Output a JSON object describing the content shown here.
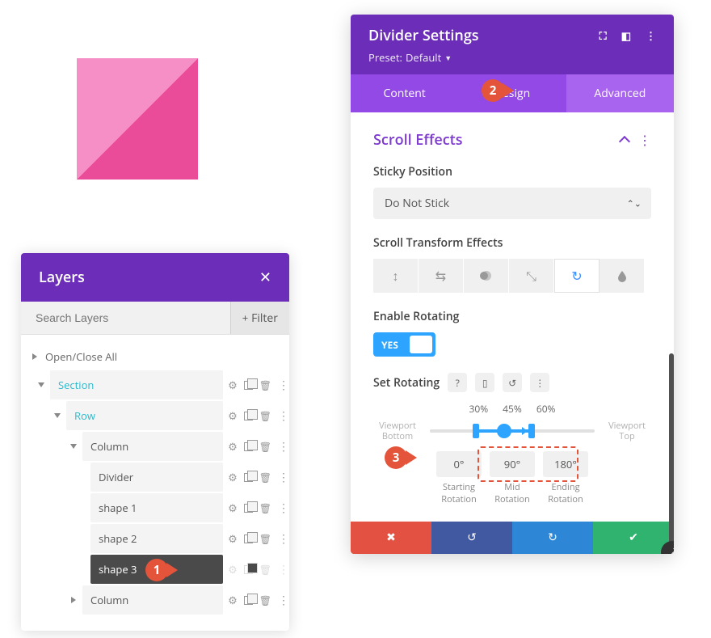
{
  "layers": {
    "title": "Layers",
    "search_placeholder": "Search Layers",
    "filter_label": "Filter",
    "open_close": "Open/Close All",
    "items": [
      {
        "label": "Section",
        "indent": 0,
        "open": true,
        "teal": true,
        "chevron": true
      },
      {
        "label": "Row",
        "indent": 1,
        "open": true,
        "teal": true,
        "chevron": true
      },
      {
        "label": "Column",
        "indent": 2,
        "open": true,
        "chevron": true
      },
      {
        "label": "Divider",
        "indent": 3
      },
      {
        "label": "shape 1",
        "indent": 3
      },
      {
        "label": "shape 2",
        "indent": 3
      },
      {
        "label": "shape 3",
        "indent": 3,
        "active": true
      },
      {
        "label": "Column",
        "indent": 2,
        "chevron": true,
        "closed": true
      }
    ]
  },
  "settings": {
    "title": "Divider Settings",
    "preset_label": "Preset:",
    "preset_value": "Default",
    "tabs": [
      "Content",
      "Design",
      "Advanced"
    ],
    "active_tab": "Advanced",
    "section": "Scroll Effects",
    "sticky_label": "Sticky Position",
    "sticky_value": "Do Not Stick",
    "transform_label": "Scroll Transform Effects",
    "enable_label": "Enable Rotating",
    "toggle_yes": "YES",
    "set_rotating": "Set Rotating",
    "percents": [
      "30%",
      "45%",
      "60%"
    ],
    "viewport_bottom": "Viewport Bottom",
    "viewport_top": "Viewport Top",
    "rotations": {
      "start": "0°",
      "mid": "90°",
      "end": "180°",
      "start_label": "Starting Rotation",
      "mid_label": "Mid Rotation",
      "end_label": "Ending Rotation"
    }
  },
  "markers": {
    "m1": "1",
    "m2": "2",
    "m3": "3"
  }
}
